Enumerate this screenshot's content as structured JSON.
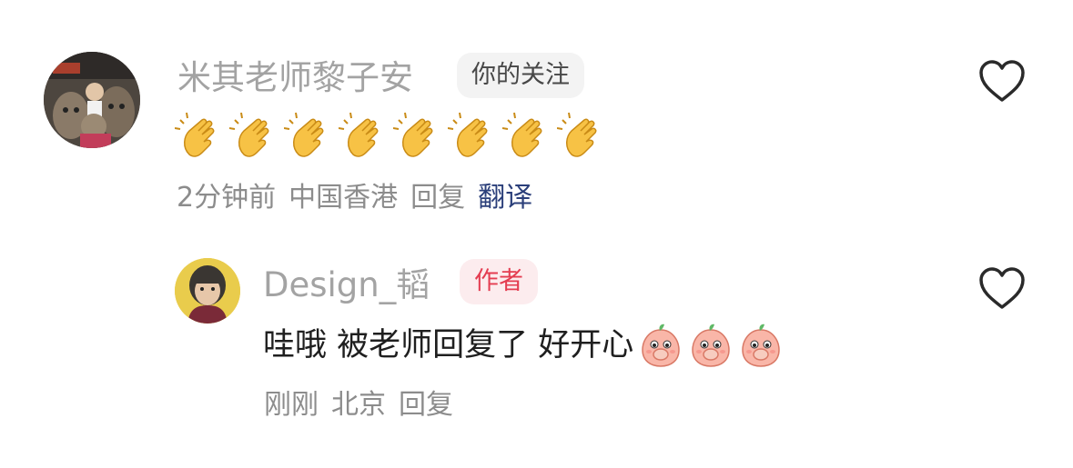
{
  "comment": {
    "username": "米其老师黎子安",
    "badge": "你的关注",
    "emoji_text": "👏👏👏👏👏👏👏👏",
    "emoji_count": 8,
    "time": "2分钟前",
    "location": "中国香港",
    "reply_label": "回复",
    "translate_label": "翻译"
  },
  "reply": {
    "username": "Design_韬",
    "badge": "作者",
    "text": "哇哦 被老师回复了 好开心",
    "sticker_count": 3,
    "time": "刚刚",
    "location": "北京",
    "reply_label": "回复"
  },
  "icons": {
    "like": "heart-outline-icon",
    "clap": "clapping-hands-emoji",
    "sticker": "peach-covering-mouth-sticker"
  },
  "colors": {
    "username": "#a3a3a3",
    "author_badge": "#e43d51",
    "translate": "#2b3f7a",
    "meta": "#8c8c8c"
  }
}
